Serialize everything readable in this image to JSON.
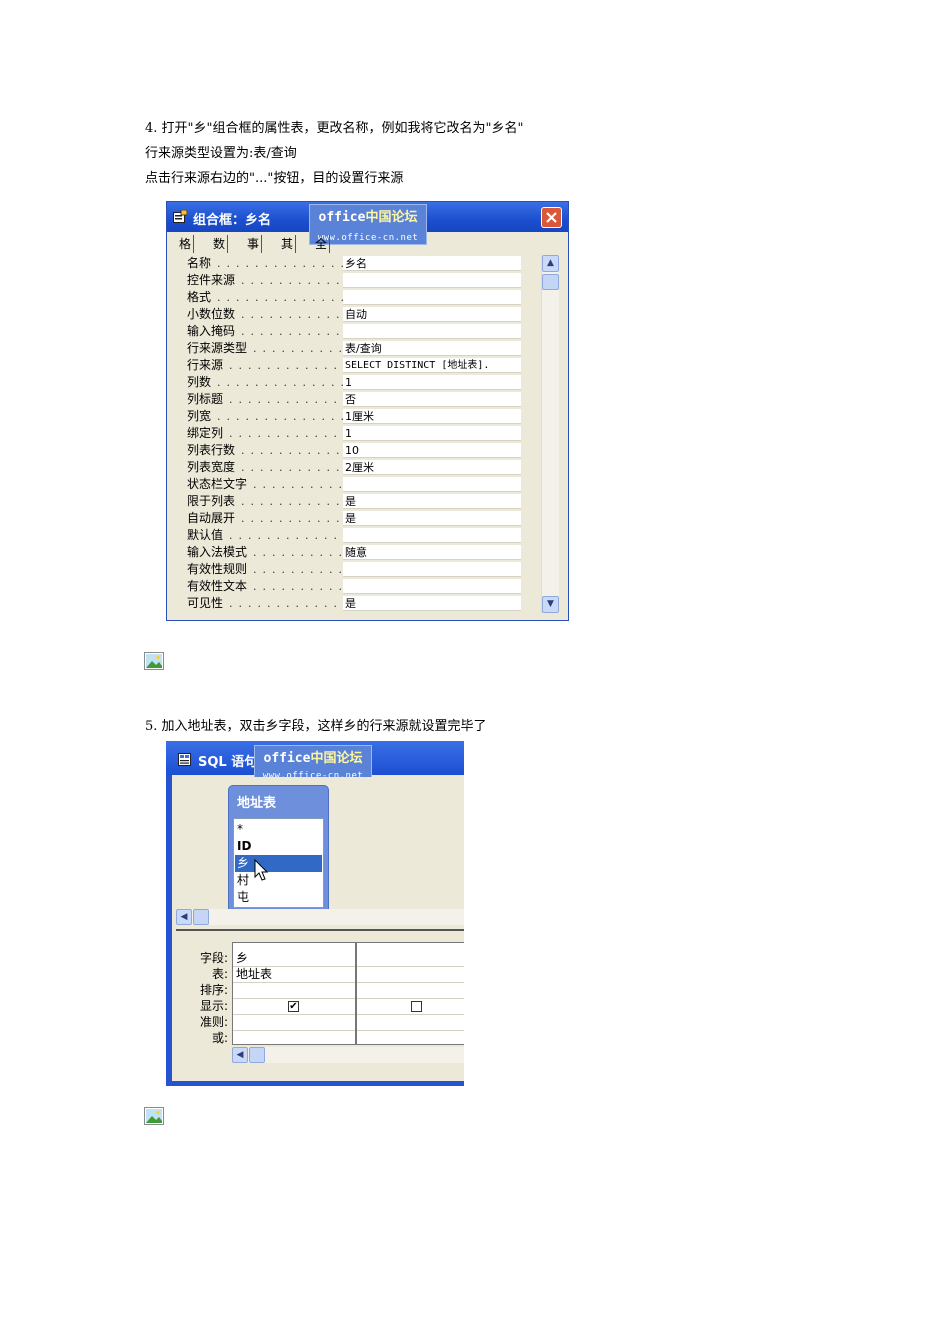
{
  "doc": {
    "step4_line1": "4. 打开\"乡\"组合框的属性表，更改名称，例如我将它改名为\"乡名\"",
    "step4_line2": "行来源类型设置为:表/查询",
    "step4_line3": "点击行来源右边的\"...\"按钮，目的设置行来源",
    "step5_line1": "5. 加入地址表，双击乡字段，这样乡的行来源就设置完毕了"
  },
  "watermark": {
    "site_prefix": "office",
    "site_cn": "中国论坛",
    "url": "www.office-cn.net"
  },
  "property_sheet": {
    "title": "组合框：乡名",
    "tabs": [
      "格式",
      "数据",
      "事件",
      "其他",
      "全部"
    ],
    "rows": [
      {
        "label": "名称",
        "value": "乡名"
      },
      {
        "label": "控件来源",
        "value": ""
      },
      {
        "label": "格式",
        "value": ""
      },
      {
        "label": "小数位数",
        "value": "自动"
      },
      {
        "label": "输入掩码",
        "value": ""
      },
      {
        "label": "行来源类型",
        "value": "表/查询"
      },
      {
        "label": "行来源",
        "value": "SELECT DISTINCT [地址表]."
      },
      {
        "label": "列数",
        "value": "1"
      },
      {
        "label": "列标题",
        "value": "否"
      },
      {
        "label": "列宽",
        "value": "1厘米"
      },
      {
        "label": "绑定列",
        "value": "1"
      },
      {
        "label": "列表行数",
        "value": "10"
      },
      {
        "label": "列表宽度",
        "value": "2厘米"
      },
      {
        "label": "状态栏文字",
        "value": ""
      },
      {
        "label": "限于列表",
        "value": "是"
      },
      {
        "label": "自动展开",
        "value": "是"
      },
      {
        "label": "默认值",
        "value": ""
      },
      {
        "label": "输入法模式",
        "value": "随意"
      },
      {
        "label": "有效性规则",
        "value": ""
      },
      {
        "label": "有效性文本",
        "value": ""
      },
      {
        "label": "可见性",
        "value": "是"
      }
    ]
  },
  "sql_window": {
    "title": "SQL 语句",
    "table_name": "地址表",
    "fields": [
      "*",
      "ID",
      "乡",
      "村",
      "屯"
    ],
    "selected_field": "乡",
    "grid_labels": [
      "字段:",
      "表:",
      "排序:",
      "显示:",
      "准则:",
      "或:"
    ],
    "columns": [
      {
        "field": "乡",
        "table": "地址表",
        "sort": "",
        "show": true
      },
      {
        "field": "",
        "table": "",
        "sort": "",
        "show": false
      }
    ]
  },
  "icons": {
    "broken_image": "broken-image-icon",
    "close": "close-icon",
    "properties": "properties-icon",
    "sql": "sql-view-icon",
    "cursor": "mouse-cursor-icon"
  }
}
